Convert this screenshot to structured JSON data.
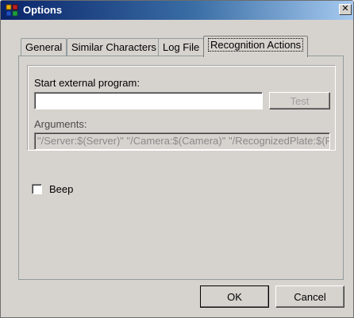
{
  "window": {
    "title": "Options",
    "close_glyph": "✕",
    "icon": "app-settings-icon"
  },
  "tabs": [
    {
      "label": "General",
      "active": false
    },
    {
      "label": "Similar Characters",
      "active": false
    },
    {
      "label": "Log File",
      "active": false
    },
    {
      "label": "Recognition Actions",
      "active": true
    }
  ],
  "recognition_actions": {
    "start_program_label": "Start external program:",
    "program_path_value": "",
    "test_button_label": "Test",
    "test_button_enabled": false,
    "arguments_label": "Arguments:",
    "arguments_value": "\"/Server:$(Server)\" \"/Camera:$(Camera)\" \"/RecognizedPlate:$(R",
    "beep_label": "Beep",
    "beep_checked": false
  },
  "footer": {
    "ok_label": "OK",
    "cancel_label": "Cancel"
  }
}
